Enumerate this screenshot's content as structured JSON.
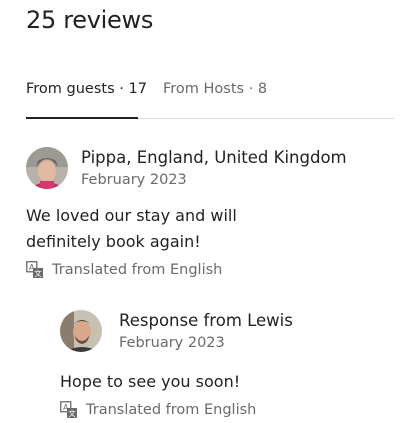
{
  "header": {
    "title": "25 reviews"
  },
  "tabs": [
    {
      "label": "From guests · 17",
      "active": true
    },
    {
      "label": "From Hosts · 8",
      "active": false
    }
  ],
  "review": {
    "author": "Pippa, England, United Kingdom",
    "date": "February 2023",
    "text_line1": "We loved our stay and will",
    "text_line2": "definitely book again!",
    "translated_label": "Translated from English",
    "translate_icon": "translate-icon"
  },
  "response": {
    "title": "Response from Lewis",
    "date": "February 2023",
    "text": "Hope to see you soon!",
    "translated_label": "Translated from English",
    "translate_icon": "translate-icon"
  }
}
